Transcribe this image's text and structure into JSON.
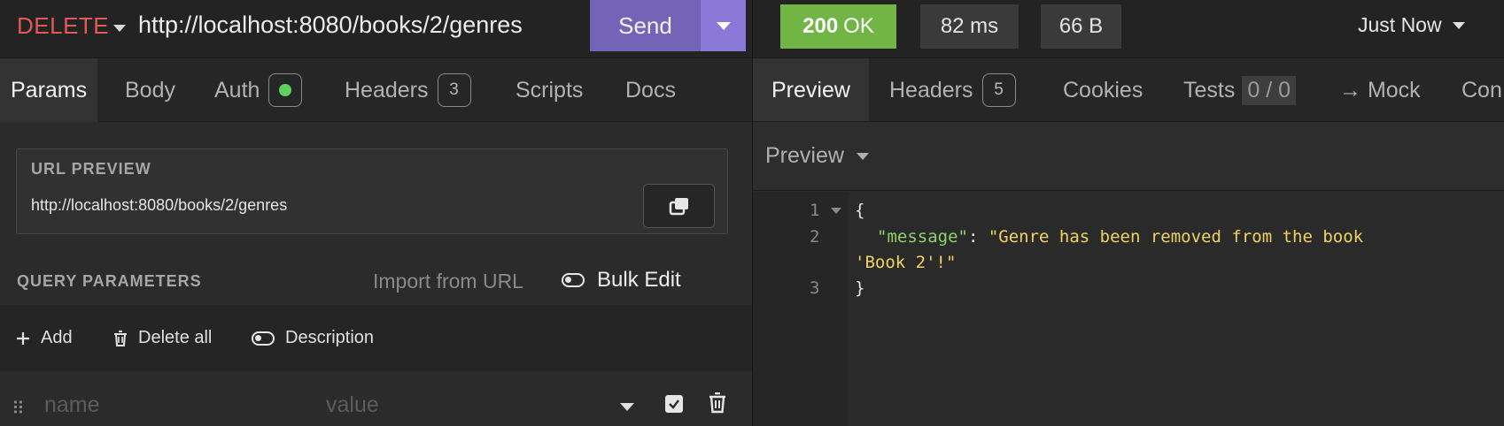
{
  "request": {
    "method": "DELETE",
    "url": "http://localhost:8080/books/2/genres",
    "send_label": "Send"
  },
  "request_tabs": {
    "params": "Params",
    "body": "Body",
    "auth": "Auth",
    "headers": "Headers",
    "headers_count": "3",
    "scripts": "Scripts",
    "docs": "Docs"
  },
  "url_preview": {
    "label": "URL PREVIEW",
    "value": "http://localhost:8080/books/2/genres"
  },
  "query_parameters": {
    "label": "QUERY PARAMETERS",
    "import_from_url": "Import from URL",
    "bulk_edit": "Bulk Edit",
    "add": "Add",
    "delete_all": "Delete all",
    "description": "Description",
    "name_placeholder": "name",
    "value_placeholder": "value"
  },
  "response": {
    "status_code": "200",
    "status_text": "OK",
    "time": "82 ms",
    "size": "66 B",
    "timestamp": "Just Now"
  },
  "response_tabs": {
    "preview": "Preview",
    "headers": "Headers",
    "headers_count": "5",
    "cookies": "Cookies",
    "tests": "Tests",
    "tests_count": "0 / 0",
    "mock": "→ Mock",
    "console_partial": "Con"
  },
  "preview_mode": "Preview",
  "response_body": {
    "line_numbers": [
      "1",
      "2",
      "3"
    ],
    "open_brace": "{",
    "key": "\"message\"",
    "colon": ": ",
    "value_line1": "\"Genre has been removed from the book",
    "value_line2": "'Book 2'!\"",
    "close_brace": "}"
  },
  "colors": {
    "method_delete": "#e05a5a",
    "send_button": "#7464b8",
    "status_ok": "#71b544",
    "json_key": "#8fd16a",
    "json_string": "#f0d264"
  }
}
